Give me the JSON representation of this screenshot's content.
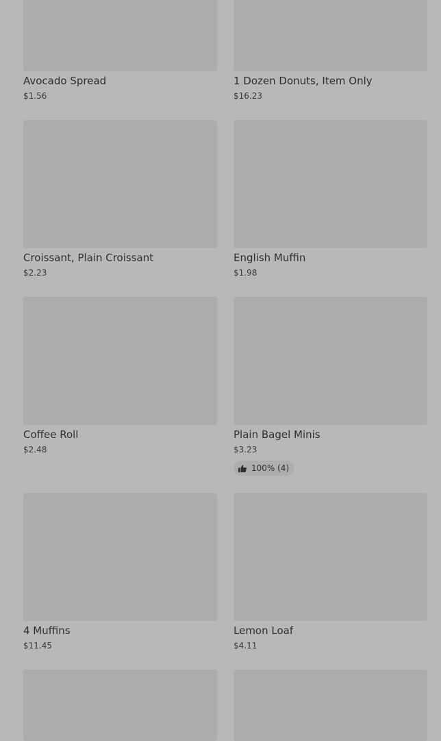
{
  "products": [
    {
      "name": "Avocado Spread",
      "price": "$1.56"
    },
    {
      "name": "1 Dozen Donuts, Item Only",
      "price": "$16.23"
    },
    {
      "name": "Croissant, Plain Croissant",
      "price": "$2.23"
    },
    {
      "name": "English Muffin",
      "price": "$1.98"
    },
    {
      "name": "Coffee Roll",
      "price": "$2.48"
    },
    {
      "name": "Plain Bagel Minis",
      "price": "$3.23",
      "rating": "100% (4)"
    },
    {
      "name": "4 Muffins",
      "price": "$11.45"
    },
    {
      "name": "Lemon Loaf",
      "price": "$4.11"
    }
  ],
  "icons": {
    "rating": "thumbs-up-icon"
  }
}
